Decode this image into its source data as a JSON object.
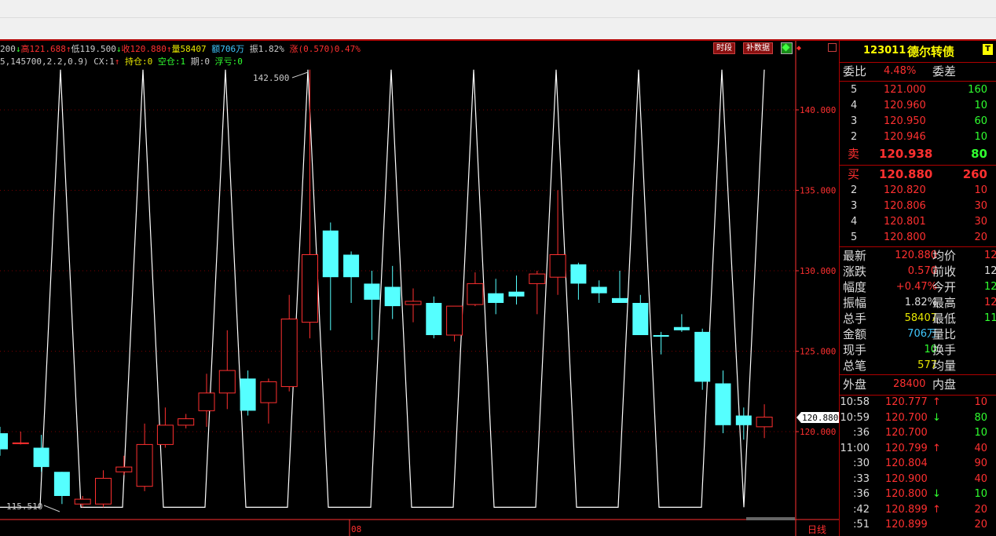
{
  "info": {
    "line1": [
      {
        "text": "200",
        "color": "#cccccc"
      },
      {
        "text": "↓",
        "color": "#30ff30"
      },
      {
        "text": "高121.688",
        "color": "#ff3030"
      },
      {
        "text": "↑",
        "color": "#ff3030"
      },
      {
        "text": "低119.500",
        "color": "#cccccc"
      },
      {
        "text": "↓",
        "color": "#30ff30"
      },
      {
        "text": "收120.880",
        "color": "#ff3030"
      },
      {
        "text": "↑",
        "color": "#ff3030"
      },
      {
        "text": "量58407 ",
        "color": "#e8e800"
      },
      {
        "text": "额706万 ",
        "color": "#40c8ff"
      },
      {
        "text": "振1.82% ",
        "color": "#cccccc"
      },
      {
        "text": "涨(0.570)0.47%",
        "color": "#ff3030"
      }
    ],
    "line2": [
      {
        "text": "5,145700,2.2,0.9)  ",
        "color": "#cccccc"
      },
      {
        "text": "CX:1",
        "color": "#cccccc"
      },
      {
        "text": "↑ ",
        "color": "#ff3030"
      },
      {
        "text": "持仓:0 ",
        "color": "#e8e800"
      },
      {
        "text": "空仓:1 ",
        "color": "#30ff30"
      },
      {
        "text": "期:0 ",
        "color": "#cccccc"
      },
      {
        "text": "浮亏:0",
        "color": "#30ff30"
      }
    ]
  },
  "buttons": {
    "period": "时段",
    "supplement": "补数据"
  },
  "chart_data": {
    "type": "candlestick",
    "y_ticks": [
      140.0,
      135.0,
      130.0,
      125.0,
      120.0
    ],
    "price_tag": "120.880",
    "max_label": "142.500",
    "min_label": "115.510",
    "axis_label": "日线",
    "x_tick_label": "08",
    "colors": {
      "up": "#ff3030",
      "down": "#55ffff",
      "grid": "#7a0000",
      "signal": "#ffffff"
    },
    "candles": [
      {
        "o": 119.9,
        "h": 120.3,
        "l": 118.5,
        "c": 118.9
      },
      {
        "o": 119.3,
        "h": 120.0,
        "l": 119.2,
        "c": 119.3
      },
      {
        "o": 119.0,
        "h": 119.8,
        "l": 117.5,
        "c": 117.8
      },
      {
        "o": 117.5,
        "h": 117.5,
        "l": 115.5,
        "c": 116.0
      },
      {
        "o": 115.5,
        "h": 116.0,
        "l": 115.3,
        "c": 115.8
      },
      {
        "o": 115.5,
        "h": 117.6,
        "l": 115.3,
        "c": 117.1
      },
      {
        "o": 117.5,
        "h": 118.5,
        "l": 117.3,
        "c": 117.8
      },
      {
        "o": 116.6,
        "h": 120.5,
        "l": 116.3,
        "c": 119.2
      },
      {
        "o": 119.2,
        "h": 121.5,
        "l": 119.0,
        "c": 120.4
      },
      {
        "o": 120.4,
        "h": 121.1,
        "l": 120.2,
        "c": 120.8
      },
      {
        "o": 121.3,
        "h": 123.6,
        "l": 120.3,
        "c": 122.4
      },
      {
        "o": 122.4,
        "h": 126.3,
        "l": 121.4,
        "c": 123.8
      },
      {
        "o": 123.3,
        "h": 123.8,
        "l": 121.0,
        "c": 121.3
      },
      {
        "o": 121.8,
        "h": 123.3,
        "l": 120.5,
        "c": 123.1
      },
      {
        "o": 122.8,
        "h": 128.5,
        "l": 122.5,
        "c": 127.0
      },
      {
        "o": 126.8,
        "h": 142.5,
        "l": 125.8,
        "c": 131.0
      },
      {
        "o": 132.5,
        "h": 133.0,
        "l": 126.3,
        "c": 129.6
      },
      {
        "o": 131.0,
        "h": 131.2,
        "l": 128.0,
        "c": 129.6
      },
      {
        "o": 129.2,
        "h": 130.0,
        "l": 125.7,
        "c": 128.2
      },
      {
        "o": 129.0,
        "h": 130.3,
        "l": 127.0,
        "c": 127.8
      },
      {
        "o": 127.9,
        "h": 128.9,
        "l": 126.8,
        "c": 128.1
      },
      {
        "o": 128.0,
        "h": 128.4,
        "l": 125.8,
        "c": 126.0
      },
      {
        "o": 126.0,
        "h": 127.5,
        "l": 125.6,
        "c": 127.8
      },
      {
        "o": 127.9,
        "h": 129.9,
        "l": 127.8,
        "c": 129.2
      },
      {
        "o": 128.6,
        "h": 129.5,
        "l": 127.3,
        "c": 128.0
      },
      {
        "o": 128.7,
        "h": 129.7,
        "l": 127.9,
        "c": 128.4
      },
      {
        "o": 129.2,
        "h": 130.0,
        "l": 127.3,
        "c": 129.8
      },
      {
        "o": 129.6,
        "h": 135.0,
        "l": 128.5,
        "c": 131.0
      },
      {
        "o": 130.4,
        "h": 130.5,
        "l": 128.2,
        "c": 129.2
      },
      {
        "o": 129.0,
        "h": 129.4,
        "l": 128.0,
        "c": 128.6
      },
      {
        "o": 128.3,
        "h": 130.0,
        "l": 128.0,
        "c": 128.0
      },
      {
        "o": 128.0,
        "h": 128.5,
        "l": 126.0,
        "c": 126.0
      },
      {
        "o": 126.0,
        "h": 126.2,
        "l": 124.8,
        "c": 125.9
      },
      {
        "o": 126.5,
        "h": 127.3,
        "l": 126.2,
        "c": 126.3
      },
      {
        "o": 126.2,
        "h": 126.4,
        "l": 122.6,
        "c": 123.1
      },
      {
        "o": 123.0,
        "h": 123.8,
        "l": 119.9,
        "c": 120.4
      },
      {
        "o": 121.0,
        "h": 121.5,
        "l": 119.5,
        "c": 120.4
      },
      {
        "o": 120.3,
        "h": 121.7,
        "l": 119.6,
        "c": 120.9
      }
    ]
  },
  "panel": {
    "code": "123011",
    "name": "德尔转债",
    "badge": "T",
    "weibi_label": "委比",
    "weibi_value": "4.48%",
    "weicha_label": "委差",
    "asks": [
      {
        "level": "5",
        "price": "121.000",
        "vol": "160"
      },
      {
        "level": "4",
        "price": "120.960",
        "vol": "10"
      },
      {
        "level": "3",
        "price": "120.950",
        "vol": "60"
      },
      {
        "level": "2",
        "price": "120.946",
        "vol": "10"
      }
    ],
    "sell1": {
      "label": "卖",
      "price": "120.938",
      "vol": "80"
    },
    "buy1": {
      "label": "买",
      "price": "120.880",
      "vol": "260"
    },
    "bids": [
      {
        "level": "2",
        "price": "120.820",
        "vol": "10"
      },
      {
        "level": "3",
        "price": "120.806",
        "vol": "30"
      },
      {
        "level": "4",
        "price": "120.801",
        "vol": "30"
      },
      {
        "level": "5",
        "price": "120.800",
        "vol": "20"
      }
    ],
    "stats": [
      {
        "l1": "最新",
        "v1": "120.880",
        "c1": "#ff3030",
        "l2": "均价",
        "v2": "12",
        "c2": "#ff3030"
      },
      {
        "l1": "涨跌",
        "v1": "0.570",
        "c1": "#ff3030",
        "l2": "前收",
        "v2": "12",
        "c2": "#dddddd"
      },
      {
        "l1": "幅度",
        "v1": "+0.47%",
        "c1": "#ff3030",
        "l2": "今开",
        "v2": "12",
        "c2": "#30ff30"
      },
      {
        "l1": "振幅",
        "v1": "1.82%",
        "c1": "#dddddd",
        "l2": "最高",
        "v2": "12",
        "c2": "#ff3030"
      },
      {
        "l1": "总手",
        "v1": "58407",
        "c1": "#e8e800",
        "l2": "最低",
        "v2": "11",
        "c2": "#30ff30"
      },
      {
        "l1": "金额",
        "v1": "706万",
        "c1": "#40c8ff",
        "l2": "量比",
        "v2": "",
        "c2": "#dddddd"
      },
      {
        "l1": "现手",
        "v1": "10",
        "c1": "#30ff30",
        "l2": "换手",
        "v2": "",
        "c2": "#dddddd"
      },
      {
        "l1": "总笔",
        "v1": "577",
        "c1": "#e8e800",
        "l2": "均量",
        "v2": "",
        "c2": "#dddddd"
      }
    ],
    "outer_label": "外盘",
    "outer_value": "28400",
    "inner_label": "内盘",
    "ticks": [
      {
        "time": "10:58",
        "price": "120.777",
        "arrow": "↑",
        "vol": "10",
        "ac": "#ff3030",
        "vc": "#ff3030"
      },
      {
        "time": "10:59",
        "price": "120.700",
        "arrow": "↓",
        "vol": "80",
        "ac": "#30ff30",
        "vc": "#30ff30"
      },
      {
        "time": ":36",
        "price": "120.700",
        "arrow": "",
        "vol": "10",
        "ac": "#30ff30",
        "vc": "#30ff30"
      },
      {
        "time": "11:00",
        "price": "120.799",
        "arrow": "↑",
        "vol": "40",
        "ac": "#ff3030",
        "vc": "#ff3030"
      },
      {
        "time": ":30",
        "price": "120.804",
        "arrow": "",
        "vol": "90",
        "ac": "#ff3030",
        "vc": "#ff3030"
      },
      {
        "time": ":33",
        "price": "120.900",
        "arrow": "",
        "vol": "40",
        "ac": "#ff3030",
        "vc": "#ff3030"
      },
      {
        "time": ":36",
        "price": "120.800",
        "arrow": "↓",
        "vol": "10",
        "ac": "#30ff30",
        "vc": "#30ff30"
      },
      {
        "time": ":42",
        "price": "120.899",
        "arrow": "↑",
        "vol": "20",
        "ac": "#ff3030",
        "vc": "#ff3030"
      },
      {
        "time": ":51",
        "price": "120.899",
        "arrow": "",
        "vol": "20",
        "ac": "#ff3030",
        "vc": "#ff3030"
      }
    ]
  }
}
